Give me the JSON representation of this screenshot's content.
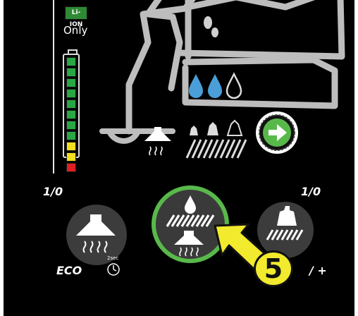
{
  "battery": {
    "type_label": "Li-ION",
    "only_label": "Only",
    "cells": [
      "#29a745",
      "#29a745",
      "#29a745",
      "#29a745",
      "#29a745",
      "#29a745",
      "#29a745",
      "#29a745",
      "#f0e020",
      "#f0e020",
      "#e02020"
    ]
  },
  "controls": {
    "vacuum_toggle_label": "1/0",
    "pressure_toggle_label": "1/0",
    "eco_label": "ECO",
    "timer_label": "2sec",
    "pressure_adjust_label": "/ +"
  },
  "callout": {
    "step_number": "5"
  },
  "colors": {
    "accent_green": "#58b94a",
    "water_blue": "#4a9fd8",
    "callout_yellow": "#f2ea2c"
  },
  "icons": [
    "machine-outline-icon",
    "water-drops-icon",
    "go-arrow-icon",
    "vacuum-hood-icon",
    "brush-pressure-icon",
    "scrub-deck-icon",
    "timer-clock-icon"
  ]
}
